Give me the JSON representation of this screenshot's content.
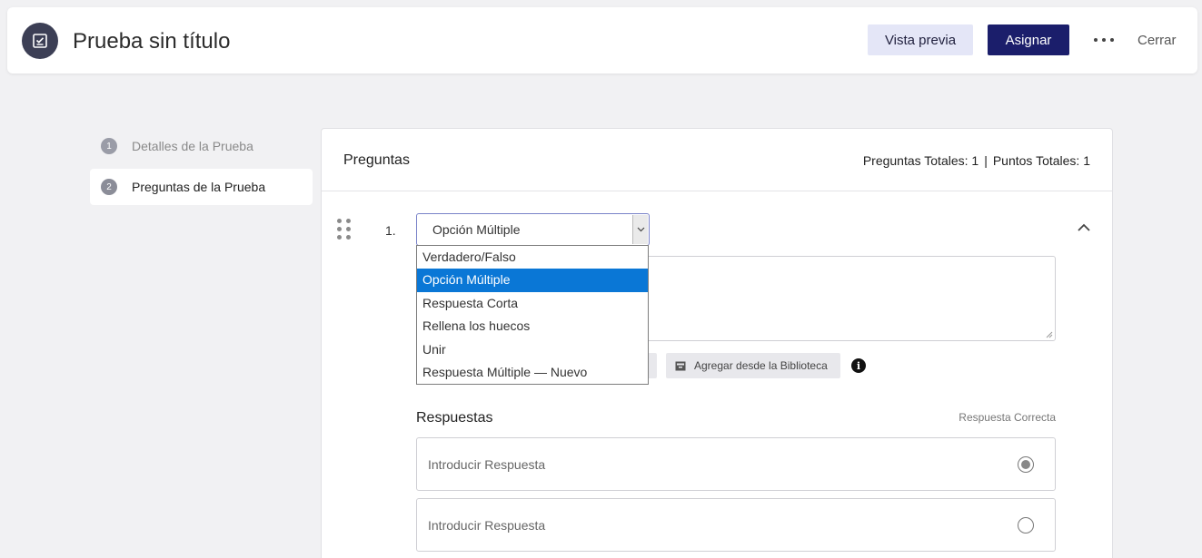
{
  "header": {
    "title": "Prueba sin título",
    "preview_label": "Vista previa",
    "assign_label": "Asignar",
    "close_label": "Cerrar",
    "app_icon": "quiz-checklist-icon",
    "more_icon": "more-horizontal-icon"
  },
  "sidebar": {
    "items": [
      {
        "number": "1",
        "label": "Detalles de la Prueba",
        "active": false
      },
      {
        "number": "2",
        "label": "Preguntas de la Prueba",
        "active": true
      }
    ]
  },
  "questions": {
    "title": "Preguntas",
    "totals_questions": "Preguntas Totales: 1",
    "totals_separator": "|",
    "totals_points": "Puntos Totales: 1",
    "question_number": "1.",
    "type_selected": "Opción Múltiple",
    "library_button": "Agregar desde la Biblioteca",
    "answers_label": "Respuestas",
    "correct_answer_label": "Respuesta Correcta",
    "answers": [
      {
        "placeholder": "Introducir Respuesta",
        "correct": true
      },
      {
        "placeholder": "Introducir Respuesta",
        "correct": false
      }
    ]
  },
  "dropdown": {
    "options": [
      {
        "label": "Verdadero/Falso",
        "selected": false
      },
      {
        "label": "Opción Múltiple",
        "selected": true
      },
      {
        "label": "Respuesta Corta",
        "selected": false
      },
      {
        "label": "Rellena los huecos",
        "selected": false
      },
      {
        "label": "Unir",
        "selected": false
      },
      {
        "label": "Respuesta Múltiple — Nuevo",
        "selected": false
      }
    ]
  },
  "colors": {
    "accent": "#1b1e6b",
    "preview_bg": "#e4e6f7",
    "selected_option": "#0a77d6"
  }
}
